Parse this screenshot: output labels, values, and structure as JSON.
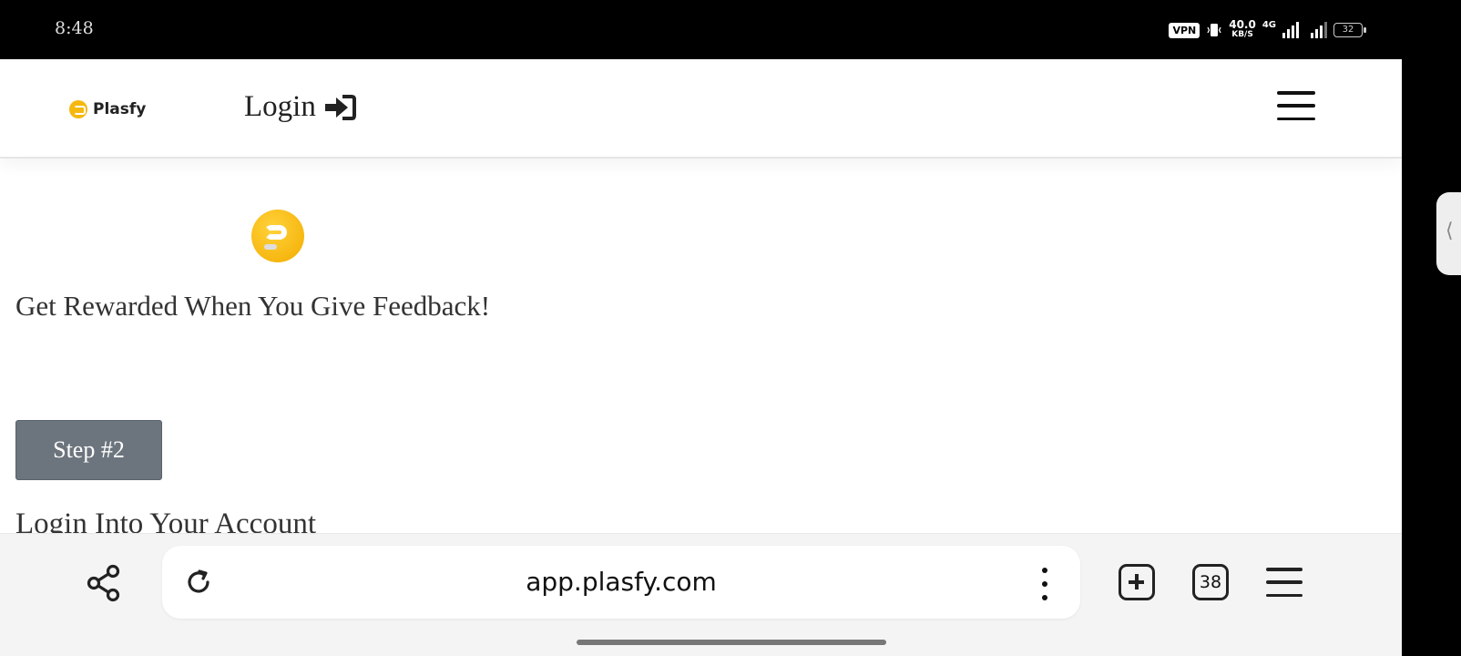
{
  "status_bar": {
    "time": "8:48",
    "vpn": "VPN",
    "speed_value": "40.0",
    "speed_unit": "KB/S",
    "network": "4G",
    "battery": "32"
  },
  "navbar": {
    "brand": "Plasfy",
    "login_label": "Login",
    "login_icon": "sign-in-icon",
    "menu_icon": "hamburger-menu-icon"
  },
  "hero": {
    "logo_icon": "plasfy-logo",
    "headline": "Get Rewarded When You Give Feedback!",
    "step_button": "Step #2",
    "subheading": "Login Into Your Account"
  },
  "browser": {
    "url": "app.plasfy.com",
    "tab_count": "38",
    "share_icon": "share-icon",
    "reload_icon": "reload-icon",
    "more_icon": "more-vertical-icon",
    "new_tab_icon": "plus-square-icon",
    "menu_icon": "menu-icon"
  },
  "colors": {
    "brand_yellow": "#f5b80e",
    "step_button_bg": "#6c757d",
    "page_bg": "#ffffff",
    "browser_bar_bg": "#f4f4f4"
  }
}
